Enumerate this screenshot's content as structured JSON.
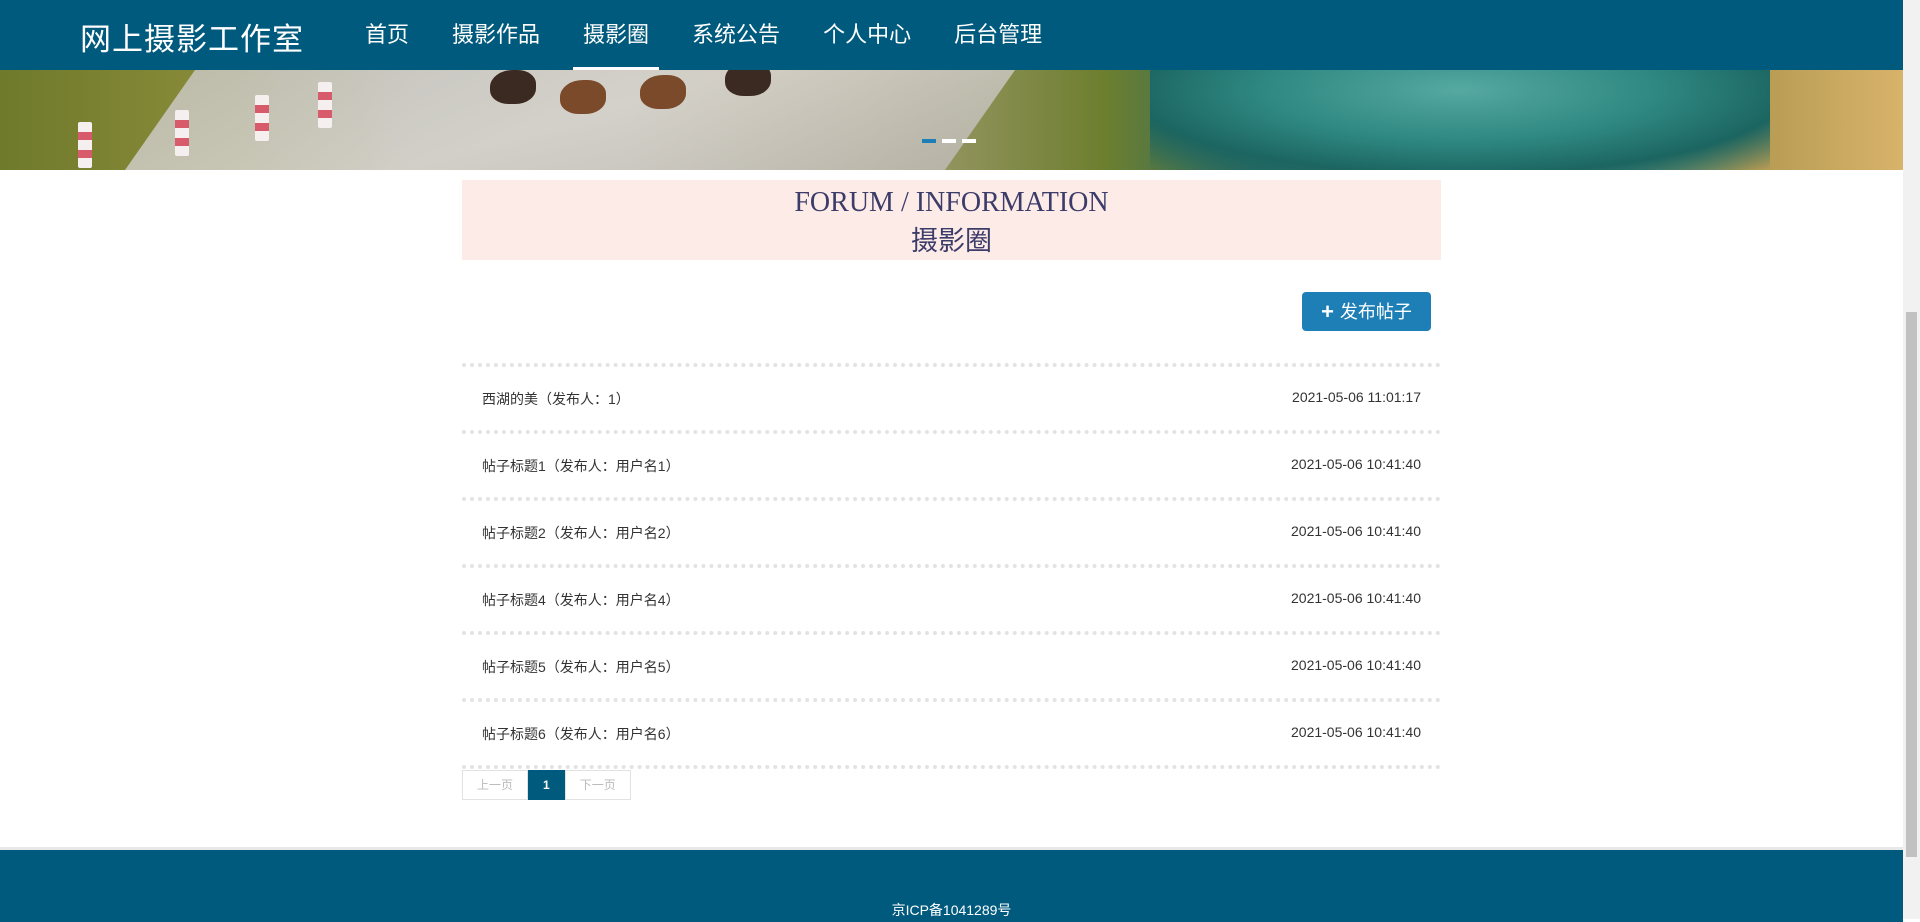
{
  "header": {
    "brand": "网上摄影工作室",
    "nav": [
      {
        "label": "首页"
      },
      {
        "label": "摄影作品"
      },
      {
        "label": "摄影圈"
      },
      {
        "label": "系统公告"
      },
      {
        "label": "个人中心"
      },
      {
        "label": "后台管理"
      }
    ],
    "active_index": 2
  },
  "banner": {
    "slides": 3,
    "active_slide": 0
  },
  "title": {
    "en": "FORUM / INFORMATION",
    "cn": "摄影圈"
  },
  "actions": {
    "post_label": "发布帖子",
    "post_icon": "plus-icon"
  },
  "posts": [
    {
      "title": "西湖的美（发布人：1）",
      "time": "2021-05-06 11:01:17"
    },
    {
      "title": "帖子标题1（发布人：用户名1）",
      "time": "2021-05-06 10:41:40"
    },
    {
      "title": "帖子标题2（发布人：用户名2）",
      "time": "2021-05-06 10:41:40"
    },
    {
      "title": "帖子标题4（发布人：用户名4）",
      "time": "2021-05-06 10:41:40"
    },
    {
      "title": "帖子标题5（发布人：用户名5）",
      "time": "2021-05-06 10:41:40"
    },
    {
      "title": "帖子标题6（发布人：用户名6）",
      "time": "2021-05-06 10:41:40"
    }
  ],
  "pager": {
    "prev": "上一页",
    "current": "1",
    "next": "下一页"
  },
  "footer": {
    "icp": "京ICP备1041289号"
  },
  "colors": {
    "primary": "#005a7d",
    "button": "#1d7fb6",
    "title_bg": "#fdebe7"
  }
}
